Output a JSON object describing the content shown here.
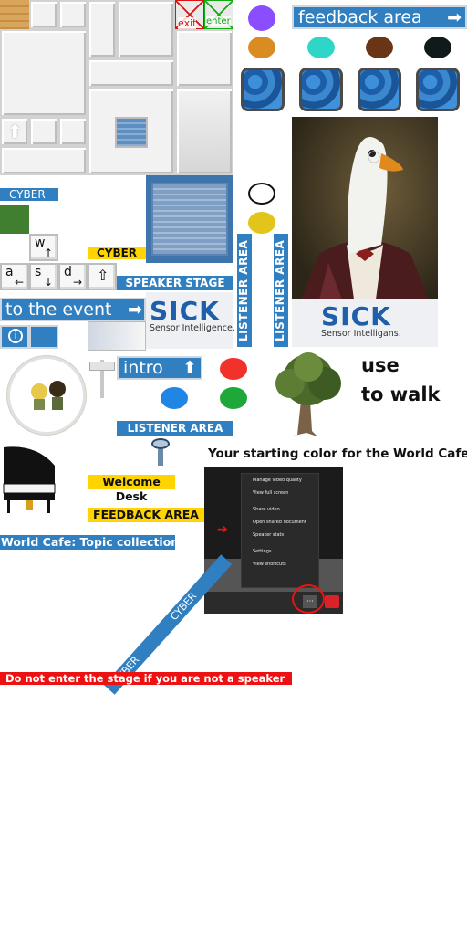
{
  "tiles": {
    "exit_label": "exit",
    "enter_label": "enter"
  },
  "buttons": {
    "feedback_area": "feedback area",
    "to_the_event": "to the event",
    "intro": "intro",
    "info_glyph": "i",
    "arrow_glyph": "➡",
    "up_glyph": "⇧"
  },
  "labels": {
    "cyber_blue": "CYBER",
    "cyber_yellow": "CYBER",
    "speaker_stage": "SPEAKER STAGE",
    "listener_area_vert_1": "LISTENER AREA",
    "listener_area_vert_2": "LISTENER AREA",
    "listener_area": "LISTENER AREA",
    "welcome_desk": "Welcome Desk",
    "feedback_area_upper": "FEEDBACK AREA",
    "world_cafe_topics": "World Cafe: Topic collection",
    "do_not_enter": "Do not enter the stage if you are not a speaker",
    "diag_cyber_1": "CYBER",
    "diag_cyber_2": "CYBER"
  },
  "instructions": {
    "use": "use",
    "to_walk": "to walk",
    "starting_color": "Your starting color for the World Cafe is"
  },
  "keys": {
    "w": "w",
    "a": "a",
    "s": "s",
    "d": "d",
    "up_arrow": "↑",
    "down_arrow": "↓",
    "left_arrow": "←",
    "right_arrow": "→",
    "shift": "⇧"
  },
  "sick_logo": {
    "brand": "SICK",
    "tagline_1": "Sensor Intelligence.",
    "brand_2": "SICK",
    "tagline_2": "Sensor Intelligans."
  },
  "menu": {
    "items": [
      "Manage video quality",
      "View full screen",
      "Share video",
      "Open shared document",
      "Speaker stats",
      "Settings",
      "View shortcuts"
    ],
    "more_glyph": "···"
  },
  "colors": {
    "purple": "#8a4dff",
    "orange": "#d98c22",
    "turquoise": "#2fd6c8",
    "brown": "#6a3516",
    "black": "#111a1a",
    "red": "#f2322a",
    "blue": "#1f86e6",
    "green": "#1fa83a",
    "yellow": "#e2c41a",
    "label_blue": "#2f7fc1",
    "label_yellow": "#ffd400"
  }
}
